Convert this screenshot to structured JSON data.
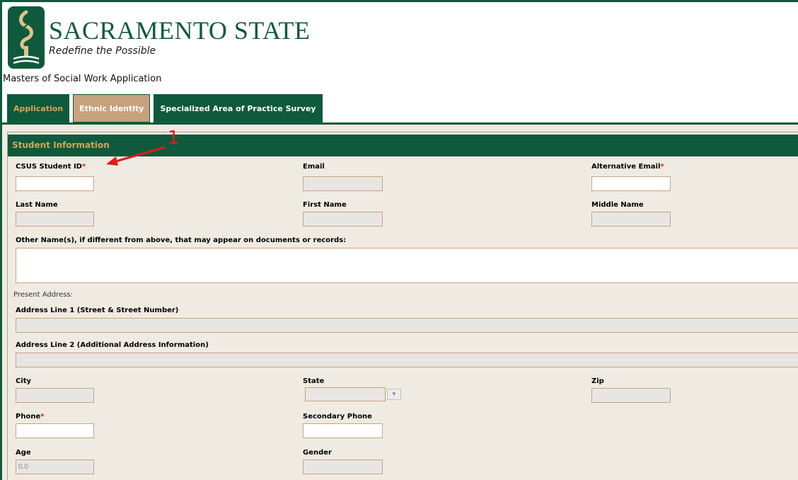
{
  "brand": {
    "name": "SACRAMENTO STATE",
    "tagline": "Redefine the Possible",
    "logo_icon": "torch-logo-icon",
    "primary_color": "#0f5a3c",
    "accent_color": "#d4a55a"
  },
  "app_title": "Masters of Social Work Application",
  "tabs": [
    {
      "label": "Application",
      "active": true
    },
    {
      "label": "Ethnic Identity",
      "active": false
    },
    {
      "label": "Specialized Area of Practice Survey",
      "active": false
    }
  ],
  "section": {
    "title": "Student Information"
  },
  "annotation": {
    "number": "1"
  },
  "fields": {
    "student_id": {
      "label": "CSUS Student ID",
      "required": "*",
      "value": ""
    },
    "email": {
      "label": "Email",
      "value": ""
    },
    "alt_email": {
      "label": "Alternative Email",
      "required": "*",
      "value": ""
    },
    "last_name": {
      "label": "Last Name",
      "value": ""
    },
    "first_name": {
      "label": "First Name",
      "value": ""
    },
    "middle_name": {
      "label": "Middle Name",
      "value": ""
    },
    "other_names": {
      "label": "Other Name(s), if different from above, that may appear on documents or records:",
      "value": ""
    },
    "present_address": {
      "label": "Present Address:"
    },
    "address1": {
      "label": "Address Line 1 (Street & Street Number)",
      "value": ""
    },
    "address2": {
      "label": "Address Line 2 (Additional Address Information)",
      "value": ""
    },
    "city": {
      "label": "City",
      "value": ""
    },
    "state": {
      "label": "State",
      "value": ""
    },
    "zip": {
      "label": "Zip",
      "value": ""
    },
    "phone": {
      "label": "Phone",
      "required": "*",
      "value": ""
    },
    "secondary_phone": {
      "label": "Secondary Phone",
      "value": ""
    },
    "age": {
      "label": "Age",
      "value": "0.0"
    },
    "gender": {
      "label": "Gender",
      "value": ""
    }
  }
}
